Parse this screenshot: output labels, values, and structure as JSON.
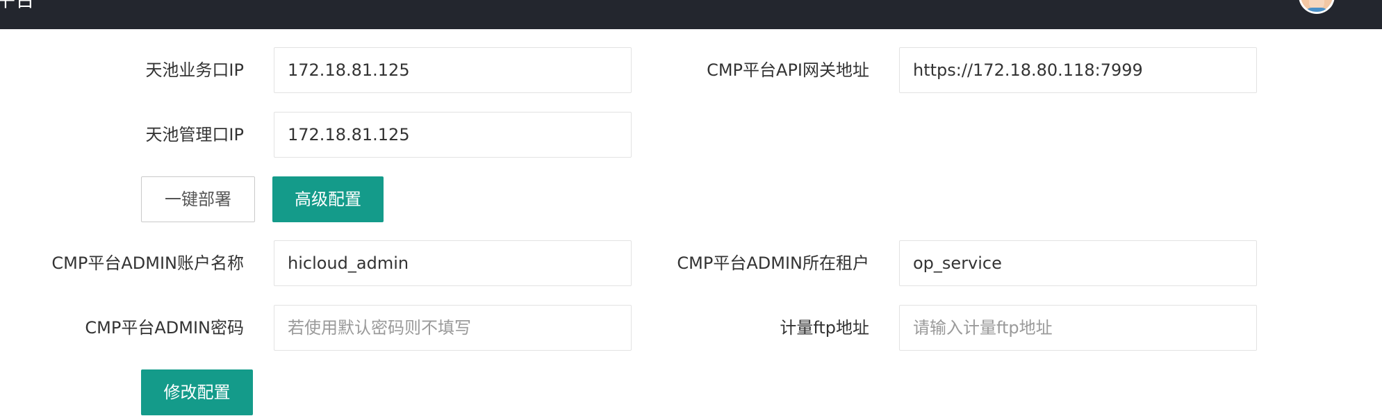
{
  "header": {
    "title": "平台",
    "avatar_icon": "user-avatar-icon"
  },
  "form": {
    "business_ip": {
      "label": "天池业务口IP",
      "value": "172.18.81.125"
    },
    "api_gateway": {
      "label": "CMP平台API网关地址",
      "value": "https://172.18.80.118:7999"
    },
    "management_ip": {
      "label": "天池管理口IP",
      "value": "172.18.81.125"
    },
    "admin_account": {
      "label": "CMP平台ADMIN账户名称",
      "value": "hicloud_admin"
    },
    "admin_tenant": {
      "label": "CMP平台ADMIN所在租户",
      "value": "op_service"
    },
    "admin_password": {
      "label": "CMP平台ADMIN密码",
      "value": "",
      "placeholder": "若使用默认密码则不填写"
    },
    "ftp_address": {
      "label": "计量ftp地址",
      "value": "",
      "placeholder": "请输入计量ftp地址"
    }
  },
  "buttons": {
    "one_click_deploy": "一键部署",
    "advanced_config": "高级配置",
    "modify_config": "修改配置"
  },
  "colors": {
    "header_bg": "#23262e",
    "primary": "#149b8a",
    "border": "#e2e2e2"
  }
}
